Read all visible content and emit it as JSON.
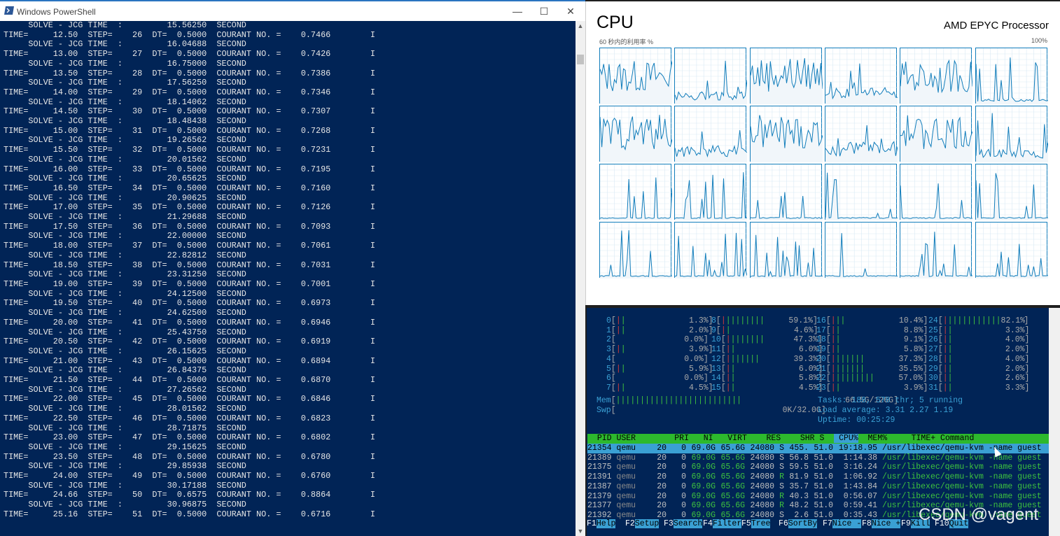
{
  "powershell": {
    "title": "Windows PowerShell",
    "min": "—",
    "max": "☐",
    "close": "✕",
    "lines": [
      "     SOLVE - JCG TIME  :         15.56250  SECOND",
      "TIME=     12.50  STEP=    26  DT=  0.5000  COURANT NO. =    0.7466        I",
      "     SOLVE - JCG TIME  :         16.04688  SECOND",
      "TIME=     13.00  STEP=    27  DT=  0.5000  COURANT NO. =    0.7426        I",
      "     SOLVE - JCG TIME  :         16.75000  SECOND",
      "TIME=     13.50  STEP=    28  DT=  0.5000  COURANT NO. =    0.7386        I",
      "     SOLVE - JCG TIME  :         17.56250  SECOND",
      "TIME=     14.00  STEP=    29  DT=  0.5000  COURANT NO. =    0.7346        I",
      "     SOLVE - JCG TIME  :         18.14062  SECOND",
      "TIME=     14.50  STEP=    30  DT=  0.5000  COURANT NO. =    0.7307        I",
      "     SOLVE - JCG TIME  :         18.48438  SECOND",
      "TIME=     15.00  STEP=    31  DT=  0.5000  COURANT NO. =    0.7268        I",
      "     SOLVE - JCG TIME  :         19.26562  SECOND",
      "TIME=     15.50  STEP=    32  DT=  0.5000  COURANT NO. =    0.7231        I",
      "     SOLVE - JCG TIME  :         20.01562  SECOND",
      "TIME=     16.00  STEP=    33  DT=  0.5000  COURANT NO. =    0.7195        I",
      "     SOLVE - JCG TIME  :         20.65625  SECOND",
      "TIME=     16.50  STEP=    34  DT=  0.5000  COURANT NO. =    0.7160        I",
      "     SOLVE - JCG TIME  :         20.90625  SECOND",
      "TIME=     17.00  STEP=    35  DT=  0.5000  COURANT NO. =    0.7126        I",
      "     SOLVE - JCG TIME  :         21.29688  SECOND",
      "TIME=     17.50  STEP=    36  DT=  0.5000  COURANT NO. =    0.7093        I",
      "     SOLVE - JCG TIME  :         22.00000  SECOND",
      "TIME=     18.00  STEP=    37  DT=  0.5000  COURANT NO. =    0.7061        I",
      "     SOLVE - JCG TIME  :         22.82812  SECOND",
      "TIME=     18.50  STEP=    38  DT=  0.5000  COURANT NO. =    0.7031        I",
      "     SOLVE - JCG TIME  :         23.31250  SECOND",
      "TIME=     19.00  STEP=    39  DT=  0.5000  COURANT NO. =    0.7001        I",
      "     SOLVE - JCG TIME  :         24.12500  SECOND",
      "TIME=     19.50  STEP=    40  DT=  0.5000  COURANT NO. =    0.6973        I",
      "     SOLVE - JCG TIME  :         24.62500  SECOND",
      "TIME=     20.00  STEP=    41  DT=  0.5000  COURANT NO. =    0.6946        I",
      "     SOLVE - JCG TIME  :         25.43750  SECOND",
      "TIME=     20.50  STEP=    42  DT=  0.5000  COURANT NO. =    0.6919        I",
      "     SOLVE - JCG TIME  :         26.15625  SECOND",
      "TIME=     21.00  STEP=    43  DT=  0.5000  COURANT NO. =    0.6894        I",
      "     SOLVE - JCG TIME  :         26.84375  SECOND",
      "TIME=     21.50  STEP=    44  DT=  0.5000  COURANT NO. =    0.6870        I",
      "     SOLVE - JCG TIME  :         27.26562  SECOND",
      "TIME=     22.00  STEP=    45  DT=  0.5000  COURANT NO. =    0.6846        I",
      "     SOLVE - JCG TIME  :         28.01562  SECOND",
      "TIME=     22.50  STEP=    46  DT=  0.5000  COURANT NO. =    0.6823        I",
      "     SOLVE - JCG TIME  :         28.71875  SECOND",
      "TIME=     23.00  STEP=    47  DT=  0.5000  COURANT NO. =    0.6802        I",
      "     SOLVE - JCG TIME  :         29.15625  SECOND",
      "TIME=     23.50  STEP=    48  DT=  0.5000  COURANT NO. =    0.6780        I",
      "     SOLVE - JCG TIME  :         29.85938  SECOND",
      "TIME=     24.00  STEP=    49  DT=  0.5000  COURANT NO. =    0.6760        I",
      "     SOLVE - JCG TIME  :         30.17188  SECOND",
      "TIME=     24.66  STEP=    50  DT=  0.6575  COURANT NO. =    0.8864        I",
      "     SOLVE - JCG TIME  :         30.96875  SECOND",
      "TIME=     25.16  STEP=    51  DT=  0.5000  COURANT NO. =    0.6716        I"
    ]
  },
  "taskmanager": {
    "title": "CPU",
    "model": "AMD EPYC Processor",
    "subtitle": "60 秒内的利用率 %",
    "max_label": "100%",
    "graph_color": "#117dbb",
    "core_activity": [
      0.55,
      0.15,
      0.6,
      0.2,
      0.55,
      0.05,
      0.6,
      0.2,
      0.6,
      0.25,
      0.6,
      0.15,
      0.02,
      0.02,
      0.02,
      0.02,
      0.02,
      0.02,
      0.02,
      0.02,
      0.02,
      0.02,
      0.02,
      0.02
    ]
  },
  "htop": {
    "cpus": [
      {
        "id": "0",
        "pct": "1.3%",
        "bar": "|"
      },
      {
        "id": "1",
        "pct": "2.0%",
        "bar": "|"
      },
      {
        "id": "2",
        "pct": "0.0%",
        "bar": ""
      },
      {
        "id": "3",
        "pct": "3.9%",
        "bar": "|"
      },
      {
        "id": "4",
        "pct": "0.0%",
        "bar": ""
      },
      {
        "id": "5",
        "pct": "5.9%",
        "bar": "|"
      },
      {
        "id": "6",
        "pct": "0.0%",
        "bar": ""
      },
      {
        "id": "7",
        "pct": "4.5%",
        "bar": "|"
      },
      {
        "id": "8",
        "pct": "59.1%",
        "bar": "||||||||"
      },
      {
        "id": "9",
        "pct": "4.6%",
        "bar": "|"
      },
      {
        "id": "10",
        "pct": "47.3%",
        "bar": "|||||||"
      },
      {
        "id": "11",
        "pct": "6.0%",
        "bar": "|"
      },
      {
        "id": "12",
        "pct": "39.3%",
        "bar": "||||||"
      },
      {
        "id": "13",
        "pct": "6.0%",
        "bar": "|"
      },
      {
        "id": "14",
        "pct": "5.8%",
        "bar": "|"
      },
      {
        "id": "15",
        "pct": "4.5%",
        "bar": "|"
      },
      {
        "id": "16",
        "pct": "10.4%",
        "bar": "||"
      },
      {
        "id": "17",
        "pct": "8.8%",
        "bar": "|"
      },
      {
        "id": "18",
        "pct": "9.1%",
        "bar": "|"
      },
      {
        "id": "19",
        "pct": "5.8%",
        "bar": "|"
      },
      {
        "id": "20",
        "pct": "37.3%",
        "bar": "||||||"
      },
      {
        "id": "21",
        "pct": "35.5%",
        "bar": "||||||"
      },
      {
        "id": "22",
        "pct": "57.0%",
        "bar": "||||||||"
      },
      {
        "id": "23",
        "pct": "3.9%",
        "bar": "|"
      },
      {
        "id": "24",
        "pct": "82.1%",
        "bar": "|||||||||||"
      },
      {
        "id": "25",
        "pct": "3.3%",
        "bar": "|"
      },
      {
        "id": "26",
        "pct": "4.0%",
        "bar": "|"
      },
      {
        "id": "27",
        "pct": "2.0%",
        "bar": "|"
      },
      {
        "id": "28",
        "pct": "4.0%",
        "bar": "|"
      },
      {
        "id": "29",
        "pct": "2.0%",
        "bar": "|"
      },
      {
        "id": "30",
        "pct": "2.6%",
        "bar": "|"
      },
      {
        "id": "31",
        "pct": "3.3%",
        "bar": "|"
      }
    ],
    "mem": {
      "label": "Mem",
      "value": "66.5G/126G"
    },
    "swp": {
      "label": "Swp",
      "value": "0K/32.0G"
    },
    "tasks": "Tasks: 188, 578 thr; 5 running",
    "load": "Load average: 3.31 2.27 1.19",
    "uptime": "Uptime: 00:25:29",
    "header": [
      "PID",
      "USER",
      "PRI",
      "NI",
      "VIRT",
      "RES",
      "SHR",
      "S",
      "CPU%",
      "MEM%",
      "TIME+",
      "Command"
    ],
    "processes": [
      {
        "pid": "21354",
        "user": "qemu",
        "pri": "20",
        "ni": "0",
        "virt": "69.0G",
        "res": "65.6G",
        "shr": "24080",
        "s": "S",
        "cpu": "455.",
        "mem": "51.0",
        "time": "19:18.95",
        "cmd": "/usr/libexec/qemu-kvm -name guest"
      },
      {
        "pid": "21389",
        "user": "qemu",
        "pri": "20",
        "ni": "0",
        "virt": "69.0G",
        "res": "65.6G",
        "shr": "24080",
        "s": "S",
        "cpu": "56.8",
        "mem": "51.0",
        "time": "1:14.38",
        "cmd": "/usr/libexec/qemu-kvm -name guest"
      },
      {
        "pid": "21375",
        "user": "qemu",
        "pri": "20",
        "ni": "0",
        "virt": "69.0G",
        "res": "65.6G",
        "shr": "24080",
        "s": "S",
        "cpu": "59.5",
        "mem": "51.0",
        "time": "3:16.24",
        "cmd": "/usr/libexec/qemu-kvm -name guest"
      },
      {
        "pid": "21391",
        "user": "qemu",
        "pri": "20",
        "ni": "0",
        "virt": "69.0G",
        "res": "65.6G",
        "shr": "24080",
        "s": "R",
        "cpu": "81.9",
        "mem": "51.0",
        "time": "1:06.92",
        "cmd": "/usr/libexec/qemu-kvm -name guest"
      },
      {
        "pid": "21387",
        "user": "qemu",
        "pri": "20",
        "ni": "0",
        "virt": "69.0G",
        "res": "65.6G",
        "shr": "24080",
        "s": "S",
        "cpu": "35.7",
        "mem": "51.0",
        "time": "1:43.84",
        "cmd": "/usr/libexec/qemu-kvm -name guest"
      },
      {
        "pid": "21379",
        "user": "qemu",
        "pri": "20",
        "ni": "0",
        "virt": "69.0G",
        "res": "65.6G",
        "shr": "24080",
        "s": "R",
        "cpu": "40.3",
        "mem": "51.0",
        "time": "0:56.07",
        "cmd": "/usr/libexec/qemu-kvm -name guest"
      },
      {
        "pid": "21377",
        "user": "qemu",
        "pri": "20",
        "ni": "0",
        "virt": "69.0G",
        "res": "65.6G",
        "shr": "24080",
        "s": "R",
        "cpu": "48.2",
        "mem": "51.0",
        "time": "0:59.41",
        "cmd": "/usr/libexec/qemu-kvm -name guest"
      },
      {
        "pid": "21392",
        "user": "qemu",
        "pri": "20",
        "ni": "0",
        "virt": "69.0G",
        "res": "65.6G",
        "shr": "24080",
        "s": "S",
        "cpu": "2.6",
        "mem": "51.0",
        "time": "0:35.43",
        "cmd": "/usr/libexec/qemu-kvm -name guest"
      }
    ],
    "fkeys": [
      {
        "k": "F1",
        "l": "Help"
      },
      {
        "k": "F2",
        "l": "Setup"
      },
      {
        "k": "F3",
        "l": "Search"
      },
      {
        "k": "F4",
        "l": "Filter"
      },
      {
        "k": "F5",
        "l": "Tree"
      },
      {
        "k": "F6",
        "l": "SortBy"
      },
      {
        "k": "F7",
        "l": "Nice -"
      },
      {
        "k": "F8",
        "l": "Nice +"
      },
      {
        "k": "F9",
        "l": "Kill"
      },
      {
        "k": "F10",
        "l": "Quit"
      }
    ]
  },
  "watermark": "CSDN @vagent"
}
